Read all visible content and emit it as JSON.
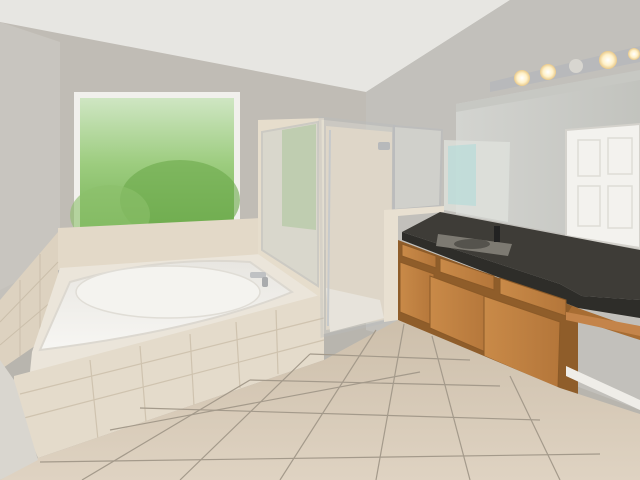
{
  "scene": {
    "description_hint": "",
    "colors": {
      "ceiling": "#e9e8e4",
      "wall_left": "#c9c6c0",
      "wall_back": "#bdb9b2",
      "wall_right": "#c3c1bc",
      "tile_beige": "#e6dccb",
      "tile_shadow": "#d4c8b4",
      "floor_tile": "#d8cbb8",
      "grout": "#9c9385",
      "tub_white": "#f2f0ec",
      "window_green": "#7ab85a",
      "window_light": "#cfe6c3",
      "glass": "#d9dcd7",
      "chrome": "#bfc1c3",
      "cabinet": "#c88a4a",
      "cabinet_dark": "#a86d33",
      "granite": "#3b3a36",
      "mirror": "#cfd0cb",
      "door_white": "#f3f2ee",
      "bulb": "#fff6da"
    },
    "objects": [
      {
        "name": "window",
        "icon": "window-icon"
      },
      {
        "name": "garden-tub",
        "icon": "bathtub-icon"
      },
      {
        "name": "glass-shower",
        "icon": "shower-icon"
      },
      {
        "name": "vanity-cabinets",
        "icon": "cabinet-icon"
      },
      {
        "name": "granite-countertop",
        "icon": "countertop-icon"
      },
      {
        "name": "wall-mirror",
        "icon": "mirror-icon"
      },
      {
        "name": "vanity-light-bar",
        "icon": "light-icon"
      },
      {
        "name": "tile-floor",
        "icon": "floor-icon"
      }
    ]
  }
}
